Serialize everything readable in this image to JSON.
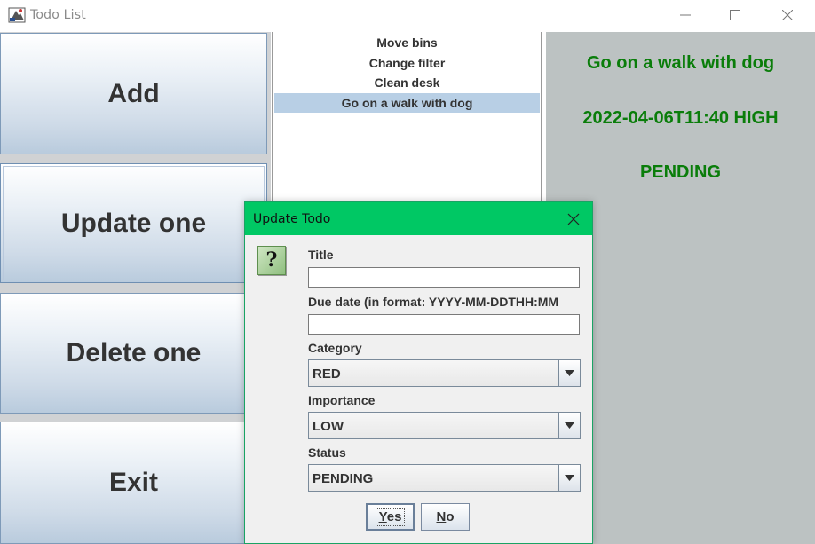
{
  "window": {
    "title": "Todo List",
    "controls": [
      "minimize-icon",
      "maximize-icon",
      "close-icon"
    ]
  },
  "actions": {
    "add": "Add",
    "update": "Update one",
    "delete": "Delete one",
    "exit": "Exit"
  },
  "todo_list": {
    "items": [
      "Move bins",
      "Change filter",
      "Clean desk",
      "Go on a walk with dog"
    ],
    "selected": "Go on a walk with dog"
  },
  "detail": {
    "title": "Go on a walk with dog",
    "due_and_importance": "2022-04-06T11:40  HIGH",
    "status": "PENDING",
    "text_color": "#0a7d0a"
  },
  "dialog": {
    "title": "Update Todo",
    "icon": "question-icon",
    "icon_glyph": "?",
    "fields": {
      "title_label": "Title",
      "title_value": "",
      "due_label": "Due date (in format: YYYY-MM-DDTHH:MM",
      "due_value": "",
      "category_label": "Category",
      "category_value": "RED",
      "importance_label": "Importance",
      "importance_value": "LOW",
      "status_label": "Status",
      "status_value": "PENDING"
    },
    "buttons": {
      "yes_mnemonic": "Y",
      "yes_rest": "es",
      "no_mnemonic": "N",
      "no_rest": "o"
    },
    "accent_color": "#00c864"
  }
}
